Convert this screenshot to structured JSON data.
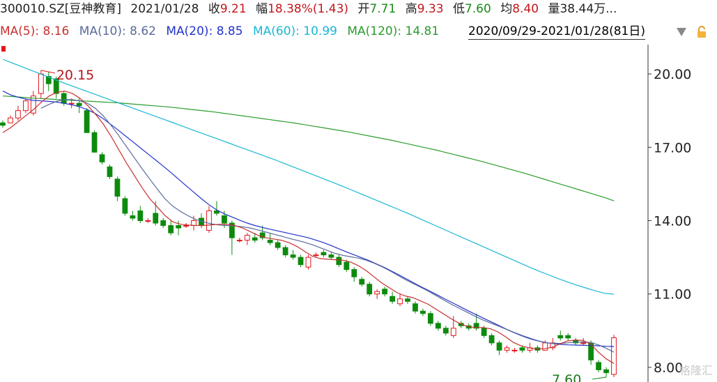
{
  "header": {
    "code": "300010.SZ[豆神教育]",
    "date": "2021/01/28",
    "close": {
      "label": "收",
      "value": "9.21"
    },
    "change": {
      "label": "幅",
      "value": "18.38%(1.43)"
    },
    "open": {
      "label": "开",
      "value": "7.71"
    },
    "high": {
      "label": "高",
      "value": "9.33"
    },
    "low": {
      "label": "低",
      "value": "7.60"
    },
    "avg": {
      "label": "均",
      "value": "8.40"
    },
    "volume": {
      "label": "量",
      "value": "38.44万..."
    }
  },
  "ma_row": {
    "ma5": "MA(5): 8.16",
    "ma10": "MA(10): 8.62",
    "ma20": "MA(20): 8.85",
    "ma60": "MA(60): 10.99",
    "ma120": "MA(120): 14.81"
  },
  "range": {
    "text": "2020/09/29-2021/01/28(81日)"
  },
  "watermark": "格隆汇",
  "colors": {
    "up": "#e3151b",
    "down": "#0d8a0d",
    "ma5": "#c8302f",
    "ma10": "#5a6a9a",
    "ma20": "#2233cc",
    "ma60": "#19b7d3",
    "ma120": "#2c9c2c",
    "axis": "#333333"
  },
  "chart_data": {
    "type": "candlestick",
    "y_ticks": [
      "20.00",
      "17.00",
      "14.00",
      "11.00",
      "8.00"
    ],
    "ylim": [
      7.4,
      21.2
    ],
    "max_label": "20.15",
    "min_label": "7.60",
    "candles": [
      [
        18.0,
        18.1,
        17.8,
        17.9
      ],
      [
        18.0,
        18.3,
        18.0,
        18.2
      ],
      [
        18.2,
        18.7,
        18.1,
        18.5
      ],
      [
        18.5,
        19.0,
        18.4,
        18.9
      ],
      [
        18.4,
        19.3,
        18.3,
        19.1
      ],
      [
        19.2,
        20.15,
        19.0,
        20.0
      ],
      [
        19.9,
        20.1,
        19.3,
        19.6
      ],
      [
        19.8,
        19.9,
        19.0,
        19.2
      ],
      [
        19.2,
        19.3,
        18.7,
        18.8
      ],
      [
        18.8,
        19.0,
        18.6,
        18.8
      ],
      [
        18.8,
        19.0,
        18.4,
        18.7
      ],
      [
        18.5,
        18.6,
        17.6,
        17.6
      ],
      [
        17.6,
        17.7,
        16.8,
        16.8
      ],
      [
        16.7,
        16.8,
        16.3,
        16.4
      ],
      [
        16.2,
        16.3,
        15.7,
        15.8
      ],
      [
        15.7,
        15.8,
        14.8,
        15.0
      ],
      [
        14.9,
        15.0,
        14.2,
        14.3
      ],
      [
        14.2,
        14.4,
        14.0,
        14.1
      ],
      [
        14.4,
        14.6,
        13.9,
        14.0
      ],
      [
        14.0,
        14.1,
        13.9,
        14.0
      ],
      [
        14.3,
        14.8,
        13.8,
        13.9
      ],
      [
        14.0,
        14.1,
        13.7,
        13.8
      ],
      [
        13.8,
        14.0,
        13.4,
        13.5
      ],
      [
        13.8,
        14.0,
        13.4,
        13.7
      ],
      [
        13.8,
        13.9,
        13.7,
        13.8
      ],
      [
        13.8,
        14.2,
        13.6,
        14.0
      ],
      [
        14.1,
        14.3,
        13.7,
        13.8
      ],
      [
        13.6,
        14.6,
        13.5,
        14.4
      ],
      [
        14.4,
        14.8,
        14.2,
        14.3
      ],
      [
        14.2,
        14.4,
        13.7,
        13.9
      ],
      [
        13.9,
        14.0,
        12.6,
        13.3
      ],
      [
        13.2,
        13.3,
        13.1,
        13.2
      ],
      [
        13.2,
        13.5,
        13.0,
        13.4
      ],
      [
        13.3,
        13.5,
        13.1,
        13.2
      ],
      [
        13.5,
        13.8,
        13.2,
        13.3
      ],
      [
        13.2,
        13.5,
        13.0,
        13.1
      ],
      [
        13.1,
        13.2,
        12.8,
        12.9
      ],
      [
        12.9,
        13.0,
        12.5,
        12.6
      ],
      [
        12.6,
        12.8,
        12.4,
        12.5
      ],
      [
        12.5,
        12.6,
        12.1,
        12.2
      ],
      [
        12.1,
        12.6,
        12.0,
        12.5
      ],
      [
        12.6,
        12.7,
        12.5,
        12.6
      ],
      [
        12.7,
        12.8,
        12.5,
        12.6
      ],
      [
        12.6,
        12.7,
        12.4,
        12.5
      ],
      [
        12.5,
        12.6,
        12.1,
        12.2
      ],
      [
        12.3,
        12.4,
        11.9,
        12.0
      ],
      [
        12.0,
        12.1,
        11.5,
        11.7
      ],
      [
        11.6,
        11.7,
        11.3,
        11.4
      ],
      [
        11.4,
        11.5,
        10.9,
        11.0
      ],
      [
        11.0,
        11.2,
        10.8,
        11.1
      ],
      [
        11.2,
        11.3,
        10.9,
        11.0
      ],
      [
        10.9,
        11.1,
        10.6,
        10.7
      ],
      [
        10.6,
        11.0,
        10.5,
        10.8
      ],
      [
        10.8,
        10.9,
        10.6,
        10.7
      ],
      [
        10.6,
        10.7,
        10.2,
        10.3
      ],
      [
        10.3,
        10.4,
        10.1,
        10.2
      ],
      [
        10.2,
        10.3,
        9.7,
        9.8
      ],
      [
        9.8,
        9.9,
        9.5,
        9.6
      ],
      [
        9.6,
        9.7,
        9.3,
        9.4
      ],
      [
        9.3,
        10.1,
        9.2,
        9.6
      ],
      [
        9.8,
        9.9,
        9.6,
        9.7
      ],
      [
        9.7,
        9.8,
        9.5,
        9.6
      ],
      [
        9.8,
        10.2,
        9.5,
        9.6
      ],
      [
        9.6,
        9.7,
        9.2,
        9.3
      ],
      [
        9.3,
        9.4,
        8.9,
        9.0
      ],
      [
        9.0,
        9.1,
        8.5,
        8.7
      ],
      [
        8.7,
        8.9,
        8.6,
        8.8
      ],
      [
        8.7,
        8.8,
        8.6,
        8.7
      ],
      [
        8.8,
        8.9,
        8.6,
        8.7
      ],
      [
        8.7,
        9.0,
        8.6,
        8.8
      ],
      [
        8.8,
        8.9,
        8.6,
        8.7
      ],
      [
        8.7,
        9.1,
        8.7,
        9.0
      ],
      [
        8.8,
        9.2,
        8.7,
        9.0
      ],
      [
        9.3,
        9.5,
        9.1,
        9.2
      ],
      [
        9.3,
        9.4,
        9.1,
        9.2
      ],
      [
        9.1,
        9.2,
        8.9,
        9.0
      ],
      [
        9.0,
        9.2,
        8.9,
        9.0
      ],
      [
        9.0,
        9.1,
        8.1,
        8.3
      ],
      [
        8.2,
        8.3,
        7.8,
        7.9
      ],
      [
        7.9,
        8.0,
        7.6,
        7.78
      ],
      [
        7.71,
        9.33,
        7.6,
        9.21
      ]
    ],
    "series": [
      {
        "name": "MA(120)",
        "start_index": 0,
        "values": [
          19.1,
          19.08,
          19.05,
          19.02,
          19.0,
          18.98,
          18.96,
          18.94,
          18.92,
          18.9,
          18.88,
          18.86,
          18.84,
          18.82,
          18.79,
          18.76,
          18.73,
          18.7,
          18.67,
          18.64,
          18.6,
          18.56,
          18.52,
          18.48,
          18.44,
          18.39,
          18.34,
          18.29,
          18.24,
          18.19,
          18.14,
          18.09,
          18.04,
          17.99,
          17.93,
          17.87,
          17.81,
          17.75,
          17.69,
          17.63,
          17.56,
          17.49,
          17.42,
          17.35,
          17.28,
          17.2,
          17.12,
          17.04,
          16.96,
          16.88,
          16.79,
          16.7,
          16.61,
          16.52,
          16.43,
          16.33,
          16.23,
          16.13,
          16.03,
          15.93,
          15.82,
          15.71,
          15.6,
          15.49,
          15.38,
          15.27,
          15.16,
          15.05,
          14.94,
          14.81
        ]
      },
      {
        "name": "MA(60)",
        "start_index": 0,
        "values": [
          20.6,
          20.45,
          20.3,
          20.15,
          20.0,
          19.85,
          19.7,
          19.56,
          19.42,
          19.28,
          19.14,
          19.0,
          18.86,
          18.72,
          18.58,
          18.44,
          18.3,
          18.16,
          18.02,
          17.88,
          17.74,
          17.6,
          17.46,
          17.32,
          17.18,
          17.04,
          16.9,
          16.76,
          16.62,
          16.48,
          16.33,
          16.18,
          16.03,
          15.88,
          15.73,
          15.58,
          15.43,
          15.27,
          15.11,
          14.95,
          14.79,
          14.63,
          14.47,
          14.31,
          14.14,
          13.97,
          13.8,
          13.63,
          13.46,
          13.29,
          13.12,
          12.95,
          12.78,
          12.61,
          12.44,
          12.27,
          12.1,
          11.94,
          11.79,
          11.64,
          11.5,
          11.37,
          11.25,
          11.13,
          11.03,
          10.99
        ]
      },
      {
        "name": "MA(20)",
        "start_index": 0,
        "values": [
          19.3,
          19.15,
          19.05,
          18.97,
          18.92,
          18.9,
          18.88,
          18.85,
          18.8,
          18.74,
          18.66,
          18.55,
          18.4,
          18.2,
          17.97,
          17.73,
          17.48,
          17.23,
          16.98,
          16.73,
          16.48,
          16.23,
          15.97,
          15.7,
          15.43,
          15.16,
          14.9,
          14.65,
          14.44,
          14.28,
          14.15,
          14.02,
          13.9,
          13.8,
          13.72,
          13.65,
          13.58,
          13.51,
          13.44,
          13.37,
          13.3,
          13.2,
          13.1,
          12.98,
          12.85,
          12.72,
          12.6,
          12.48,
          12.36,
          12.22,
          12.08,
          11.92,
          11.76,
          11.59,
          11.42,
          11.26,
          11.1,
          10.94,
          10.78,
          10.62,
          10.46,
          10.3,
          10.15,
          10.0,
          9.85,
          9.7,
          9.55,
          9.42,
          9.3,
          9.19,
          9.09,
          9.02,
          8.97,
          8.94,
          8.92,
          8.91,
          8.9,
          8.89,
          8.88,
          8.86,
          8.85
        ]
      },
      {
        "name": "MA(10)",
        "start_index": 5,
        "values": [
          18.6,
          18.75,
          18.88,
          18.95,
          18.95,
          18.9,
          18.8,
          18.6,
          18.3,
          17.92,
          17.5,
          17.05,
          16.6,
          16.15,
          15.72,
          15.3,
          14.9,
          14.6,
          14.38,
          14.2,
          14.05,
          13.95,
          13.87,
          13.82,
          13.8,
          13.78,
          13.75,
          13.7,
          13.62,
          13.54,
          13.45,
          13.37,
          13.28,
          13.2,
          13.12,
          13.02,
          12.9,
          12.78,
          12.66,
          12.58,
          12.52,
          12.47,
          12.38,
          12.26,
          12.12,
          11.96,
          11.78,
          11.6,
          11.44,
          11.28,
          11.12,
          10.94,
          10.76,
          10.58,
          10.42,
          10.26,
          10.1,
          9.95,
          9.82,
          9.7,
          9.57,
          9.43,
          9.3,
          9.18,
          9.09,
          9.02,
          8.98,
          8.98,
          9.0,
          9.03,
          9.04,
          9.01,
          8.92,
          8.78,
          8.62
        ]
      },
      {
        "name": "MA(5)",
        "start_index": 0,
        "values": [
          17.6,
          17.8,
          18.05,
          18.3,
          18.55,
          18.85,
          19.1,
          19.25,
          19.3,
          19.2,
          19.0,
          18.7,
          18.35,
          17.95,
          17.45,
          16.9,
          16.35,
          15.85,
          15.35,
          14.9,
          14.55,
          14.2,
          13.95,
          13.85,
          13.82,
          13.8,
          13.8,
          13.83,
          13.85,
          13.85,
          13.8,
          13.7,
          13.55,
          13.4,
          13.3,
          13.25,
          13.2,
          13.1,
          12.95,
          12.75,
          12.55,
          12.45,
          12.42,
          12.4,
          12.38,
          12.3,
          12.15,
          11.95,
          11.7,
          11.45,
          11.25,
          11.05,
          10.92,
          10.85,
          10.72,
          10.58,
          10.38,
          10.18,
          9.98,
          9.8,
          9.68,
          9.63,
          9.63,
          9.58,
          9.45,
          9.25,
          9.02,
          8.88,
          8.8,
          8.75,
          8.76,
          8.82,
          8.95,
          9.08,
          9.12,
          9.1,
          8.95,
          8.62,
          8.35,
          8.16
        ]
      }
    ]
  }
}
